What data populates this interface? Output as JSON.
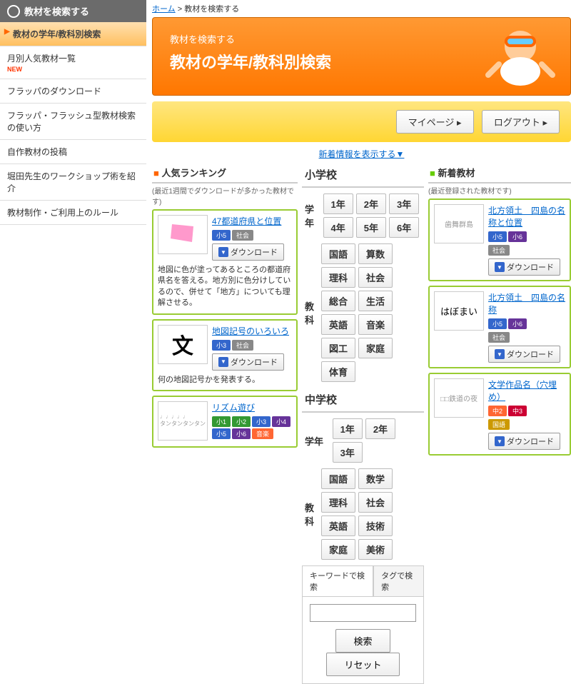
{
  "breadcrumb": {
    "home": "ホーム",
    "current": "教材を検索する"
  },
  "sidebar": {
    "header": "教材を検索する",
    "items": [
      {
        "label": "教材の学年/教科別検索"
      },
      {
        "label": "月別人気教材一覧",
        "new": "NEW"
      },
      {
        "label": "フラッパのダウンロード"
      },
      {
        "label": "フラッパ・フラッシュ型教材検索の使い方"
      },
      {
        "label": "自作教材の投稿"
      },
      {
        "label": "堀田先生のワークショップ術を紹介"
      },
      {
        "label": "教材制作・ご利用上のルール"
      }
    ]
  },
  "hero": {
    "sub": "教材を検索する",
    "title": "教材の学年/教科別検索"
  },
  "buttons": {
    "mypage": "マイページ",
    "logout": "ログアウト"
  },
  "newinfo": "新着情報を表示する▼",
  "ranking": {
    "title": "人気ランキング",
    "sub": "(最近1週間でダウンロードが多かった教材です)",
    "items": [
      {
        "title": "47都道府県と位置",
        "tags": [
          {
            "t": "小5",
            "c": "blue"
          },
          {
            "t": "社会",
            "c": "gray"
          }
        ],
        "desc": "地図に色が塗ってあるところの都道府県名を答える。地方別に色分けしているので、併せて「地方」についても理解させる。"
      },
      {
        "title": "地図記号のいろいろ",
        "tags": [
          {
            "t": "小3",
            "c": "blue"
          },
          {
            "t": "社会",
            "c": "gray"
          }
        ],
        "desc": "何の地図記号かを発表する。"
      },
      {
        "title": "リズム遊び",
        "tags": [
          {
            "t": "小1",
            "c": "green"
          },
          {
            "t": "小2",
            "c": "green"
          },
          {
            "t": "小3",
            "c": "blue"
          },
          {
            "t": "小4",
            "c": "purple"
          },
          {
            "t": "小5",
            "c": "blue"
          },
          {
            "t": "小6",
            "c": "purple"
          },
          {
            "t": "音楽",
            "c": "orange"
          }
        ],
        "desc": ""
      }
    ]
  },
  "download": "ダウンロード",
  "search": {
    "elementary": {
      "title": "小学校",
      "grade_label": "学年",
      "grades": [
        "1年",
        "2年",
        "3年",
        "4年",
        "5年",
        "6年"
      ],
      "subject_label": "教科",
      "subjects": [
        "国語",
        "算数",
        "理科",
        "社会",
        "総合",
        "生活",
        "英語",
        "音楽",
        "図工",
        "家庭",
        "体育"
      ]
    },
    "junior": {
      "title": "中学校",
      "grade_label": "学年",
      "grades": [
        "1年",
        "2年",
        "3年"
      ],
      "subject_label": "教科",
      "subjects": [
        "国語",
        "数学",
        "理科",
        "社会",
        "英語",
        "技術",
        "家庭",
        "美術"
      ]
    },
    "tabs": [
      "キーワードで検索",
      "タグで検索"
    ],
    "submit": "検索",
    "reset": "リセット"
  },
  "newitems": {
    "title": "新着教材",
    "sub": "(最近登録された教材です)",
    "items": [
      {
        "title": "北方領土　四島の名称と位置",
        "thumb": "歯舞群島",
        "tags": [
          {
            "t": "小5",
            "c": "blue"
          },
          {
            "t": "小6",
            "c": "purple"
          },
          {
            "t": "社会",
            "c": "gray"
          }
        ]
      },
      {
        "title": "北方領土　四島の名称",
        "thumb": "はぼまい",
        "tags": [
          {
            "t": "小5",
            "c": "blue"
          },
          {
            "t": "小6",
            "c": "purple"
          },
          {
            "t": "社会",
            "c": "gray"
          }
        ]
      },
      {
        "title": "文学作品名（穴埋め）",
        "thumb": "□□鉄道の夜",
        "tags": [
          {
            "t": "中2",
            "c": "orange"
          },
          {
            "t": "中3",
            "c": "red"
          },
          {
            "t": "国語",
            "c": "yellow"
          }
        ]
      }
    ]
  }
}
